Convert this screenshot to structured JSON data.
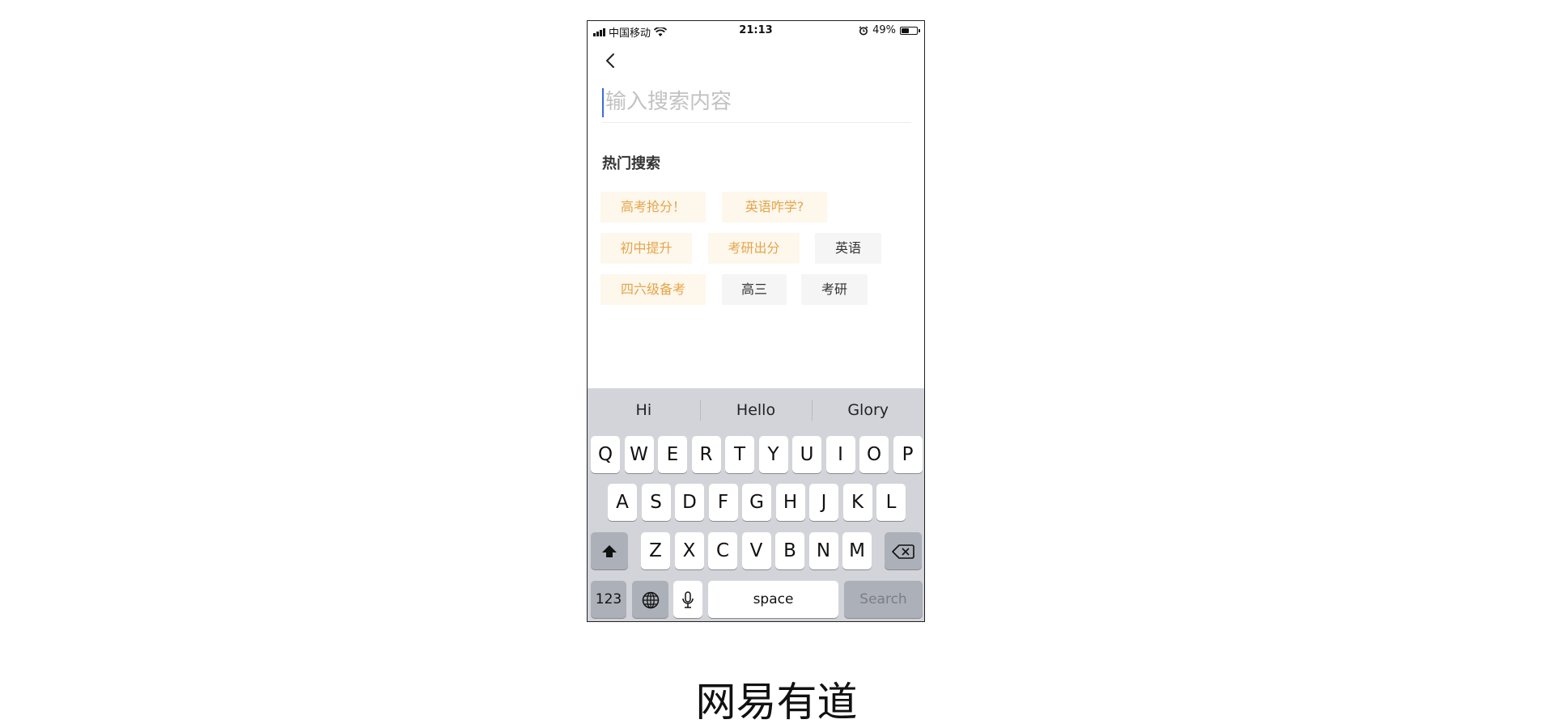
{
  "statusbar": {
    "carrier": "中国移动",
    "time": "21:13",
    "battery": "49%",
    "battery_level": 0.49,
    "icons": [
      "signal-icon",
      "wifi-icon",
      "alarm-icon",
      "battery-icon"
    ]
  },
  "header": {
    "back_icon": "chevron-left-icon"
  },
  "search": {
    "placeholder": "输入搜索内容",
    "value": ""
  },
  "hot": {
    "title": "热门搜索",
    "tags": [
      {
        "label": "高考抢分！",
        "style": "hot"
      },
      {
        "label": "英语咋学?",
        "style": "hot"
      },
      {
        "label": "初中提升",
        "style": "hot"
      },
      {
        "label": "考研出分",
        "style": "hot"
      },
      {
        "label": "英语",
        "style": "normal"
      },
      {
        "label": "四六级备考",
        "style": "hot"
      },
      {
        "label": "高三",
        "style": "normal"
      },
      {
        "label": "考研",
        "style": "normal"
      }
    ]
  },
  "keyboard": {
    "suggestions": [
      "Hi",
      "Hello",
      "Glory"
    ],
    "row1": [
      "Q",
      "W",
      "E",
      "R",
      "T",
      "Y",
      "U",
      "I",
      "O",
      "P"
    ],
    "row2": [
      "A",
      "S",
      "D",
      "F",
      "G",
      "H",
      "J",
      "K",
      "L"
    ],
    "row3": [
      "Z",
      "X",
      "C",
      "V",
      "B",
      "N",
      "M"
    ],
    "numbers_label": "123",
    "space_label": "space",
    "search_label": "Search"
  },
  "caption": "网易有道",
  "colors": {
    "hot_tag_bg": "#fdf7ec",
    "hot_tag_text": "#e6a449",
    "normal_tag_bg": "#f5f5f5",
    "keyboard_bg": "#d2d4d9",
    "caret": "#3b6cd6"
  }
}
